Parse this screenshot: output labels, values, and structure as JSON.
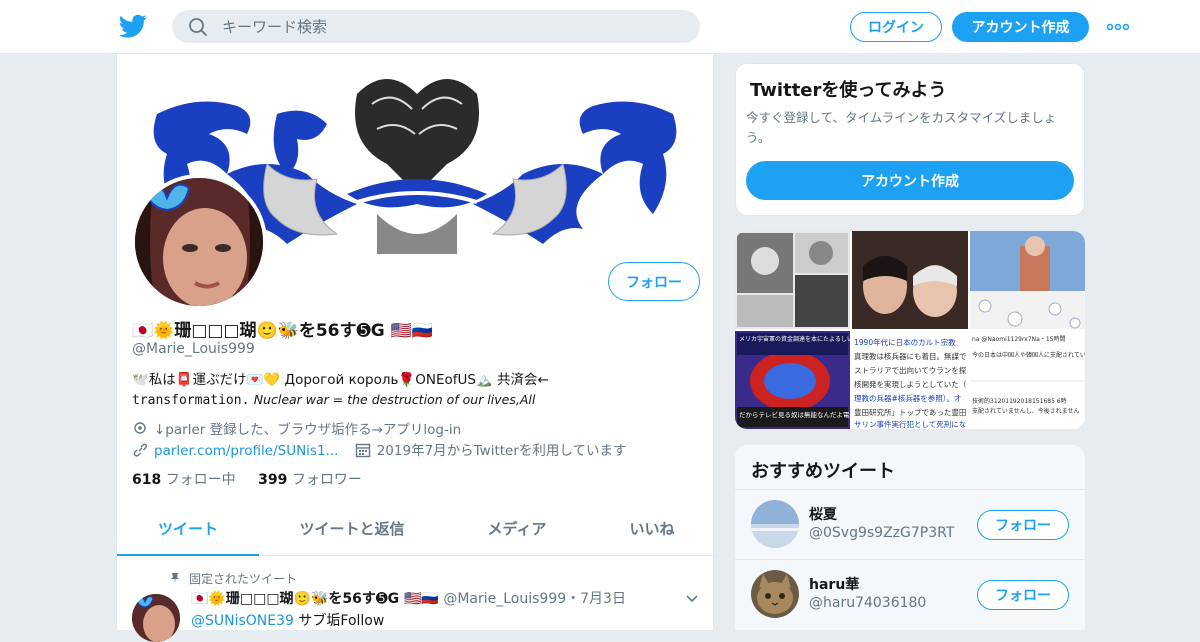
{
  "header": {
    "search_placeholder": "キーワード検索",
    "login_label": "ログイン",
    "signup_label": "アカウント作成",
    "brand_color": "#1da1f2"
  },
  "profile": {
    "display_name": "🇯🇵🌞珊□□□瑚🙂🐝を56す➎G 🇺🇸🇷🇺",
    "handle": "@Marie_Louis999",
    "follow_label": "フォロー",
    "bio_line1": "🕊️私は📮運ぶだけ💌💛 Дорогой король🌹ONEofUS🏔️ 共済会←",
    "bio_mono": "transformation.",
    "bio_italic": "Nuclear war = the destruction of our lives,All",
    "location": "↓parler 登録した、ブラウザ垢作る→アプリlog-in",
    "url": "parler.com/profile/SUNis1...",
    "joined": "2019年7月からTwitterを利用しています",
    "following_count": "618",
    "following_label": "フォロー中",
    "followers_count": "399",
    "followers_label": "フォロワー"
  },
  "tabs": [
    {
      "label": "ツイート"
    },
    {
      "label": "ツイートと返信"
    },
    {
      "label": "メディア"
    },
    {
      "label": "いいね"
    }
  ],
  "pinned_tweet": {
    "pinned_label": "固定されたツイート",
    "name": "🇯🇵🌞珊□□□瑚🙂🐝を56す➎G 🇺🇸🇷🇺",
    "handle_date": "@Marie_Louis999・7月3日",
    "mention": "@SUNisONE39",
    "text": " サブ垢Follow"
  },
  "signup_card": {
    "title": "Twitterを使ってみよう",
    "desc": "今すぐ登録して、タイムラインをカスタマイズしましょう。",
    "button": "アカウント作成"
  },
  "media_text": {
    "t1": "メリカ宇宙軍の資金調達を本にたよるしいから見事の後金投入でさらなる事態となる",
    "t2": "だからテレビ見る奴は無能なんだよ電通の繰り人形",
    "t3": "1990年代に日本のカルト宗教",
    "t4": "真理教は核兵器にも着目。無謀で",
    "t5": "ストラリアで出向いてウランを探",
    "t6": "核開発を実現しようとしていた（",
    "t7": "理教の兵器#核兵器を参照）。オ",
    "t8": "豊田研究所」トップであった豊田",
    "t9": "サリン事件実行犯として死刑にな",
    "t10": "na @Naomi1129rx7Na・15時間",
    "t11": "今の日本は中国人や韓国人に支配されていると言われていますが、その問題はありますか？",
    "t12": "技術的31201192018151685 6時",
    "t13": "支配されていませんし、今後されません"
  },
  "recommended": {
    "title": "おすすめツイート",
    "users": [
      {
        "name": "桜夏",
        "handle": "@0Svg9s9ZzG7P3RT",
        "follow": "フォロー"
      },
      {
        "name": "haru華",
        "handle": "@haru74036180",
        "follow": "フォロー"
      }
    ]
  }
}
